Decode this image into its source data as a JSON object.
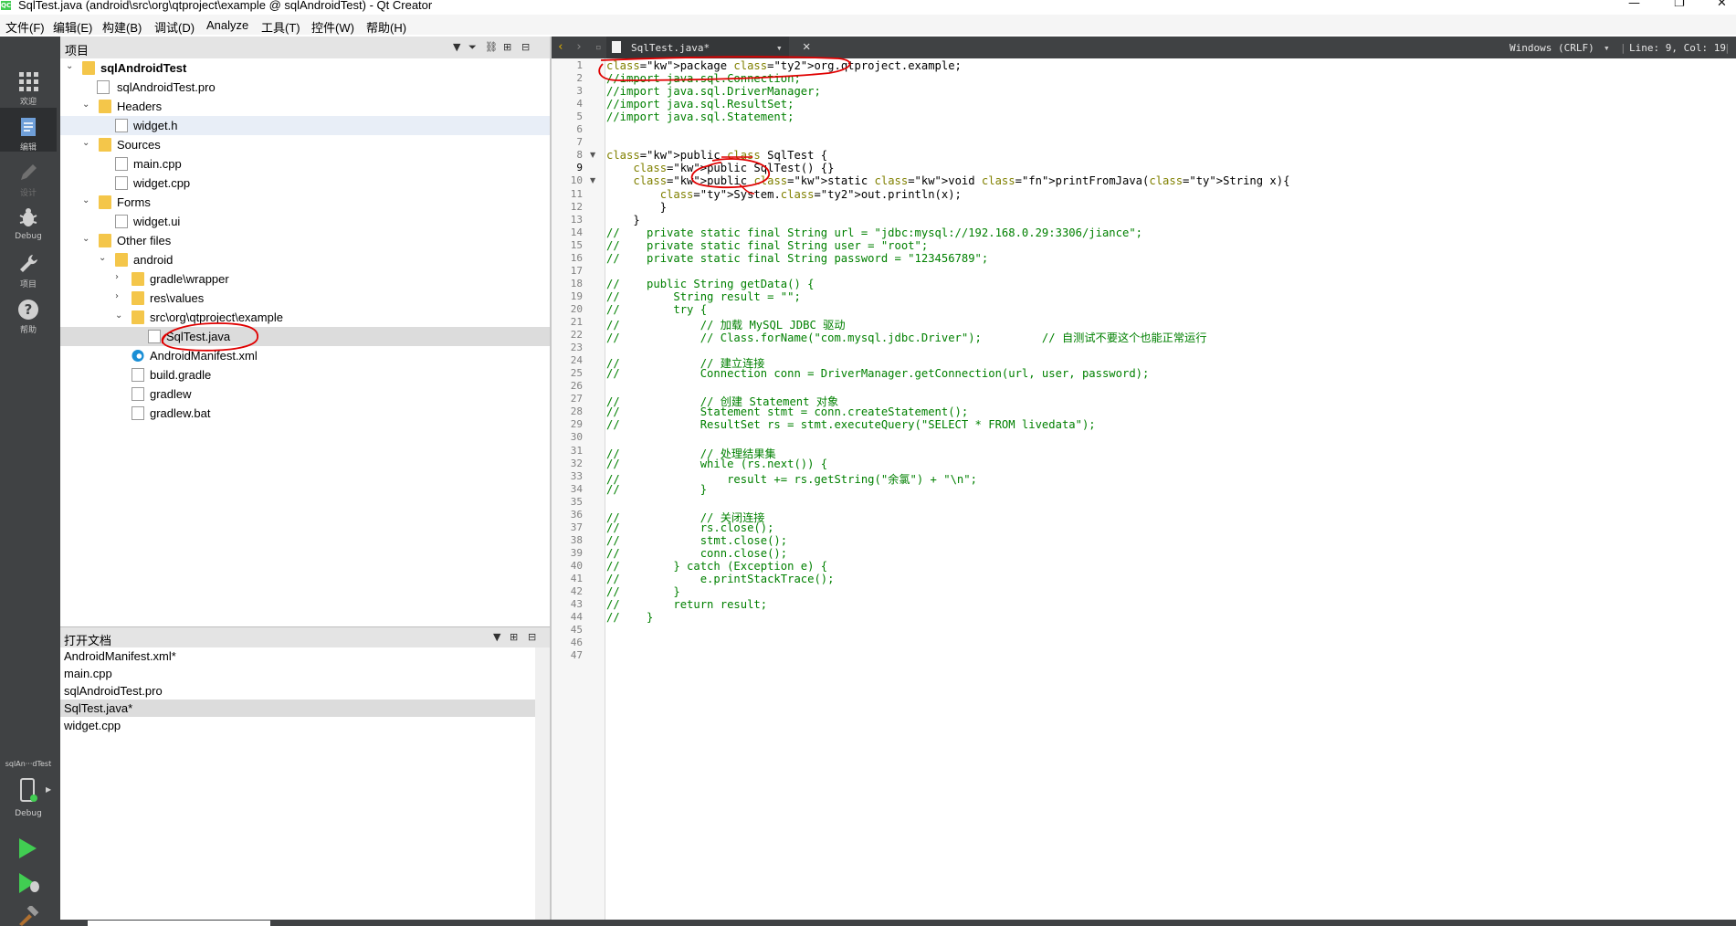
{
  "window": {
    "title": "SqlTest.java (android\\src\\org\\qtproject\\example @ sqlAndroidTest) - Qt Creator",
    "logo": "QC",
    "controls": [
      "—",
      "❐",
      "✕"
    ]
  },
  "menu": [
    "文件(F)",
    "编辑(E)",
    "构建(B)",
    "调试(D)",
    "Analyze",
    "工具(T)",
    "控件(W)",
    "帮助(H)"
  ],
  "modes": [
    "欢迎",
    "编辑",
    "设计",
    "Debug",
    "项目",
    "帮助"
  ],
  "kit": {
    "project": "sqlAn···dTest",
    "mode": "Debug"
  },
  "project_panel": {
    "title": "项目",
    "tree": [
      {
        "label": "sqlAndroidTest",
        "bold": true
      },
      {
        "label": "sqlAndroidTest.pro"
      },
      {
        "label": "Headers"
      },
      {
        "label": "widget.h"
      },
      {
        "label": "Sources"
      },
      {
        "label": "main.cpp"
      },
      {
        "label": "widget.cpp"
      },
      {
        "label": "Forms"
      },
      {
        "label": "widget.ui"
      },
      {
        "label": "Other files"
      },
      {
        "label": "android"
      },
      {
        "label": "gradle\\wrapper"
      },
      {
        "label": "res\\values"
      },
      {
        "label": "src\\org\\qtproject\\example"
      },
      {
        "label": "SqlTest.java"
      },
      {
        "label": "AndroidManifest.xml"
      },
      {
        "label": "build.gradle"
      },
      {
        "label": "gradlew"
      },
      {
        "label": "gradlew.bat"
      }
    ]
  },
  "open_docs": {
    "title": "打开文档",
    "items": [
      "AndroidManifest.xml*",
      "main.cpp",
      "sqlAndroidTest.pro",
      "SqlTest.java*",
      "widget.cpp"
    ]
  },
  "editor": {
    "file_tab": "SqlTest.java*",
    "encoding": "Windows (CRLF)",
    "position": "Line: 9, Col: 19",
    "current_line": 9,
    "lines": [
      "package org.qtproject.example;",
      "//import java.sql.Connection;",
      "//import java.sql.DriverManager;",
      "//import java.sql.ResultSet;",
      "//import java.sql.Statement;",
      "",
      "",
      "public class SqlTest {",
      "    public SqlTest() {}",
      "    public static void printFromJava(String x){",
      "        System.out.println(x);",
      "        }",
      "    }",
      "//    private static final String url = \"jdbc:mysql://192.168.0.29:3306/jiance\";",
      "//    private static final String user = \"root\";",
      "//    private static final String password = \"123456789\";",
      "",
      "//    public String getData() {",
      "//        String result = \"\";",
      "//        try {",
      "//            // 加载 MySQL JDBC 驱动",
      "//            // Class.forName(\"com.mysql.jdbc.Driver\");         // 自测试不要这个也能正常运行",
      "",
      "//            // 建立连接",
      "//            Connection conn = DriverManager.getConnection(url, user, password);",
      "",
      "//            // 创建 Statement 对象",
      "//            Statement stmt = conn.createStatement();",
      "//            ResultSet rs = stmt.executeQuery(\"SELECT * FROM livedata\");",
      "",
      "//            // 处理结果集",
      "//            while (rs.next()) {",
      "//                result += rs.getString(\"余氯\") + \"\\n\";",
      "//            }",
      "",
      "//            // 关闭连接",
      "//            rs.close();",
      "//            stmt.close();",
      "//            conn.close();",
      "//        } catch (Exception e) {",
      "//            e.printStackTrace();",
      "//        }",
      "//        return result;",
      "//    }",
      "",
      "",
      ""
    ]
  },
  "colors": {
    "mode_bar": "#404244",
    "keyword": "#808000",
    "comment": "#008000",
    "annotation": "#e00000"
  }
}
